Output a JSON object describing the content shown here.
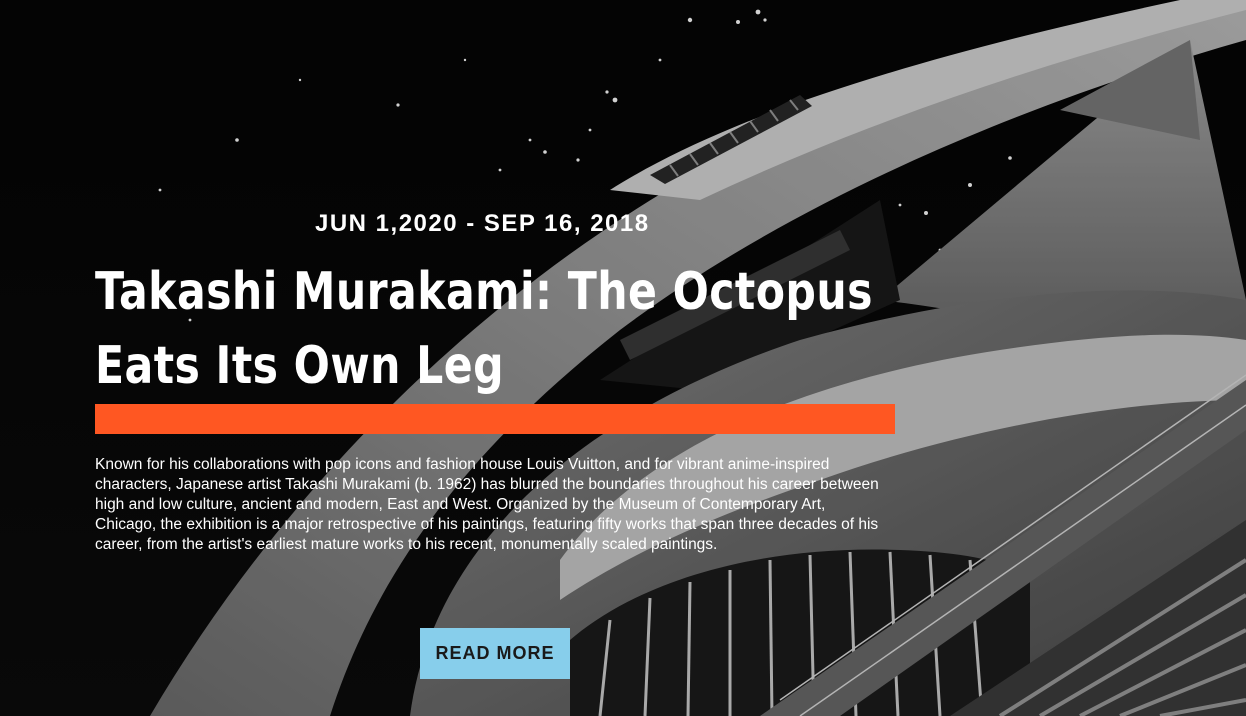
{
  "hero": {
    "date_range": "JUN 1,2020 - SEP 16, 2018",
    "title": "Takashi Murakami: The Octopus Eats Its Own Leg",
    "description": "Known for his collaborations with pop icons and fashion house Louis Vuitton, and for vibrant anime-inspired characters, Japanese artist Takashi Murakami (b. 1962) has blurred the boundaries throughout his career between high and low culture, ancient and modern, East and West. Organized by the Museum of Contemporary Art, Chicago, the exhibition is a major retrospective of his paintings, featuring fifty works that span three decades of his career, from the artist's earliest mature works to his recent, monumentally scaled paintings.",
    "read_more_label": "READ MORE",
    "background_image": "night-sky-futuristic-architecture"
  },
  "colors": {
    "accent_bar": "#ff5722",
    "button_bg": "#87ceeb",
    "text": "#ffffff",
    "background": "#000000"
  }
}
